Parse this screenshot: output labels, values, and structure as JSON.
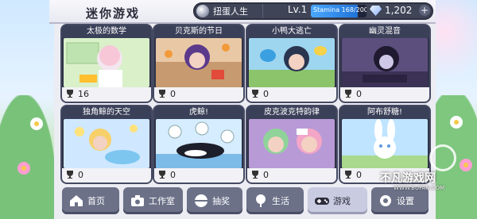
{
  "header": {
    "title": "迷你游戏",
    "gacha_label": "扭蛋人生",
    "level": "Lv.1",
    "stamina": "Stamina 168/200",
    "stamina_fraction": 0.84,
    "gems": "1,202",
    "plus": "+"
  },
  "cards": [
    {
      "title": "太极的数学",
      "score": "16"
    },
    {
      "title": "贝克斯的节日",
      "score": "0"
    },
    {
      "title": "小鸭大逃亡",
      "score": "0"
    },
    {
      "title": "幽灵混音",
      "score": "0"
    },
    {
      "title": "独角鲸的天空",
      "score": "0"
    },
    {
      "title": "虎鲸!",
      "score": "0"
    },
    {
      "title": "皮克波克特韵律",
      "score": "0"
    },
    {
      "title": "阿布舒糖!",
      "score": "0"
    }
  ],
  "nav": {
    "home": "首页",
    "studio": "工作室",
    "lottery": "抽奖",
    "life": "生活",
    "games": "游戏",
    "settings": "设置"
  },
  "watermark": {
    "main": "不凡游戏网",
    "sub": "WWW.BUFAN.COM"
  },
  "colors": {
    "accent": "#3f4457",
    "card_bg": "#2f3347"
  }
}
